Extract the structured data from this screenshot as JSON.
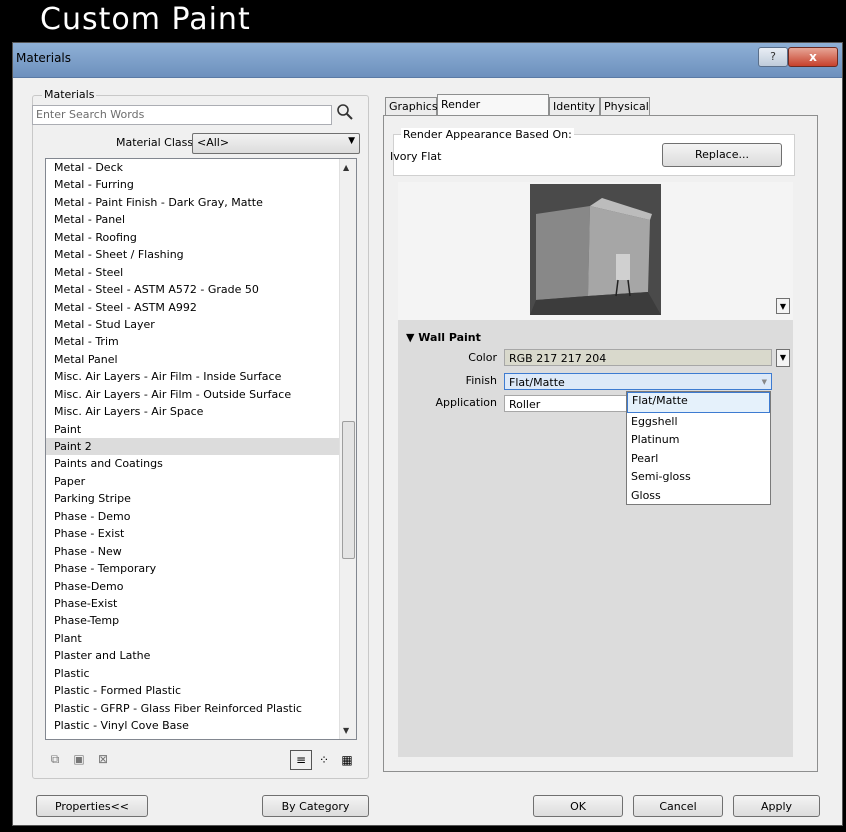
{
  "slide_title": "Custom Paint",
  "window": {
    "title": "Materials",
    "help": "?",
    "close": "x"
  },
  "left": {
    "group_label": "Materials",
    "search_placeholder": "Enter Search Words",
    "material_class_label": "Material Class:",
    "material_class_value": "<All>",
    "items": [
      "Metal - Deck",
      "Metal - Furring",
      "Metal - Paint Finish - Dark Gray, Matte",
      "Metal - Panel",
      "Metal - Roofing",
      "Metal - Sheet / Flashing",
      "Metal - Steel",
      "Metal - Steel - ASTM A572 - Grade 50",
      "Metal - Steel - ASTM A992",
      "Metal - Stud Layer",
      "Metal - Trim",
      "Metal Panel",
      "Misc. Air Layers - Air Film - Inside Surface",
      "Misc. Air Layers - Air Film - Outside Surface",
      "Misc. Air Layers - Air Space",
      "Paint",
      "Paint 2",
      "Paints and Coatings",
      "Paper",
      "Parking Stripe",
      "Phase - Demo",
      "Phase - Exist",
      "Phase - New",
      "Phase - Temporary",
      "Phase-Demo",
      "Phase-Exist",
      "Phase-Temp",
      "Plant",
      "Plaster and Lathe",
      "Plastic",
      "Plastic - Formed Plastic",
      "Plastic - GFRP -  Glass Fiber Reinforced Plastic",
      "Plastic - Vinyl Cove Base"
    ],
    "selected_item": "Paint 2"
  },
  "tabs": [
    "Graphics",
    "Render Appearance",
    "Identity",
    "Physical"
  ],
  "active_tab": "Render Appearance",
  "render": {
    "group_label": "Render Appearance Based On:",
    "based_on": "Ivory Flat",
    "replace_label": "Replace..."
  },
  "wall_paint": {
    "header": "Wall Paint",
    "color_label": "Color",
    "color_value": "RGB 217 217 204",
    "color_hex": "#d9d9cc",
    "finish_label": "Finish",
    "finish_value": "Flat/Matte",
    "application_label": "Application",
    "application_value": "Roller",
    "finish_options": [
      "Flat/Matte",
      "Eggshell",
      "Platinum",
      "Pearl",
      "Semi-gloss",
      "Gloss"
    ]
  },
  "buttons": {
    "properties": "Properties<<",
    "by_category": "By Category",
    "ok": "OK",
    "cancel": "Cancel",
    "apply": "Apply"
  }
}
